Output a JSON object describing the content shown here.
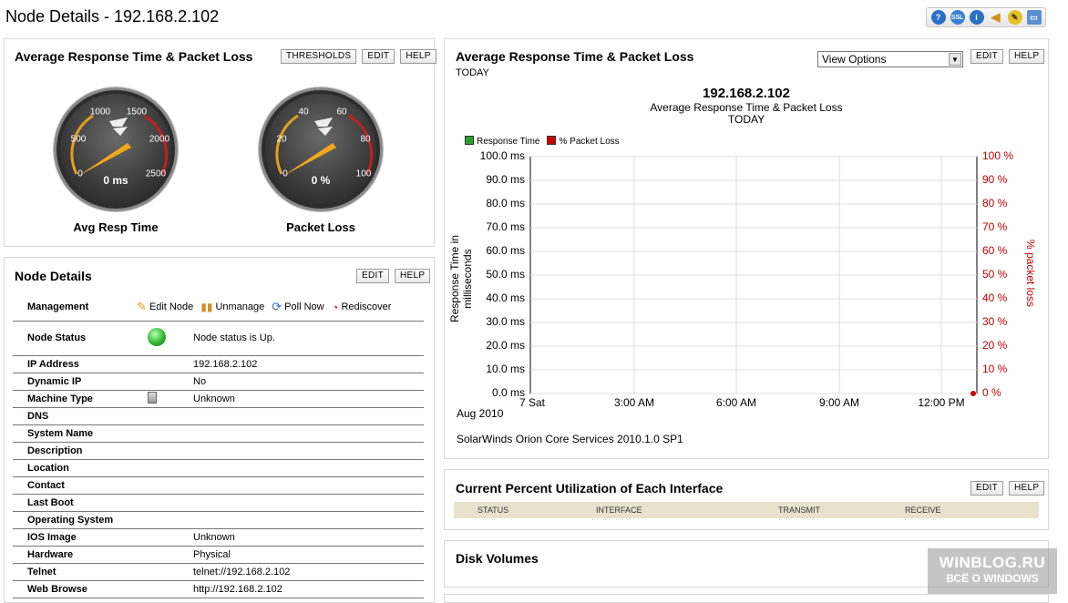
{
  "page": {
    "title": "Node Details - 192.168.2.102"
  },
  "top_icons": [
    "help-icon",
    "ssl-icon",
    "info-icon",
    "sound-icon",
    "tools-icon",
    "monitor-icon"
  ],
  "gauges_panel": {
    "title": "Average Response Time & Packet Loss",
    "buttons": {
      "thresholds": "THRESHOLDS",
      "edit": "EDIT",
      "help": "HELP"
    },
    "gauges": [
      {
        "label": "Avg Resp Time",
        "value_text": "0 ms",
        "value": 0,
        "max": 2500,
        "ticks": [
          "0",
          "500",
          "1000",
          "1500",
          "2000",
          "2500"
        ]
      },
      {
        "label": "Packet Loss",
        "value_text": "0 %",
        "value": 0,
        "max": 100,
        "ticks": [
          "0",
          "20",
          "40",
          "60",
          "80",
          "100"
        ]
      }
    ]
  },
  "node_details": {
    "title": "Node Details",
    "buttons": {
      "edit": "EDIT",
      "help": "HELP"
    },
    "management": {
      "label": "Management",
      "actions": {
        "edit_node": "Edit Node",
        "unmanage": "Unmanage",
        "poll_now": "Poll Now",
        "rediscover": "Rediscover"
      }
    },
    "node_status": {
      "label": "Node Status",
      "value": "Node status is Up."
    },
    "rows": [
      {
        "key": "IP Address",
        "value": "192.168.2.102"
      },
      {
        "key": "Dynamic IP",
        "value": "No"
      },
      {
        "key": "Machine Type",
        "value": "Unknown"
      },
      {
        "key": "DNS",
        "value": ""
      },
      {
        "key": "System Name",
        "value": ""
      },
      {
        "key": "Description",
        "value": ""
      },
      {
        "key": "Location",
        "value": ""
      },
      {
        "key": "Contact",
        "value": ""
      },
      {
        "key": "Last Boot",
        "value": ""
      },
      {
        "key": "Operating System",
        "value": ""
      },
      {
        "key": "IOS Image",
        "value": "Unknown"
      },
      {
        "key": "Hardware",
        "value": "Physical"
      },
      {
        "key": "Telnet",
        "value": "telnet://192.168.2.102"
      },
      {
        "key": "Web Browse",
        "value": "http://192.168.2.102"
      }
    ]
  },
  "chart_panel": {
    "title": "Average Response Time & Packet Loss",
    "subtitle": "TODAY",
    "view_options": "View Options",
    "buttons": {
      "edit": "EDIT",
      "help": "HELP"
    },
    "footer": "SolarWinds Orion Core Services 2010.1.0 SP1"
  },
  "chart_data": {
    "type": "line",
    "title": "192.168.2.102",
    "subtitle": "Average Response Time & Packet Loss",
    "subtitle2": "TODAY",
    "series": [
      {
        "name": "Response Time",
        "color": "#2e9e2e",
        "axis": "left",
        "values": []
      },
      {
        "name": "% Packet Loss",
        "color": "#cc0000",
        "axis": "right",
        "values": [
          0
        ]
      }
    ],
    "ylabel": "Response Time in milliseconds",
    "y2label": "% packet loss",
    "ylim": [
      0,
      100
    ],
    "y2lim": [
      0,
      100
    ],
    "yticks": [
      "100.0 ms",
      "90.0 ms",
      "80.0 ms",
      "70.0 ms",
      "60.0 ms",
      "50.0 ms",
      "40.0 ms",
      "30.0 ms",
      "20.0 ms",
      "10.0 ms",
      "0.0 ms"
    ],
    "y2ticks": [
      "100 %",
      "90 %",
      "80 %",
      "70 %",
      "60 %",
      "50 %",
      "40 %",
      "30 %",
      "20 %",
      "10 %",
      "0 %"
    ],
    "xticks": [
      "7 Sat",
      "3:00 AM",
      "6:00 AM",
      "9:00 AM",
      "12:00 PM"
    ],
    "xlabel_extra": "Aug 2010",
    "grid": true,
    "legend": "top-left"
  },
  "interfaces_panel": {
    "title": "Current Percent Utilization of Each Interface",
    "buttons": {
      "edit": "EDIT",
      "help": "HELP"
    },
    "columns": [
      "STATUS",
      "INTERFACE",
      "TRANSMIT",
      "RECEIVE"
    ]
  },
  "disk_panel": {
    "title": "Disk Volumes"
  },
  "watermark": {
    "line1": "WINBLOG.RU",
    "line2": "ВСЁ О WINDOWS"
  },
  "colors": {
    "status_up": "#2db82d",
    "gauge_needle": "#f0a818",
    "gauge_zone": "#e0a020",
    "loss_red": "#c00000"
  }
}
